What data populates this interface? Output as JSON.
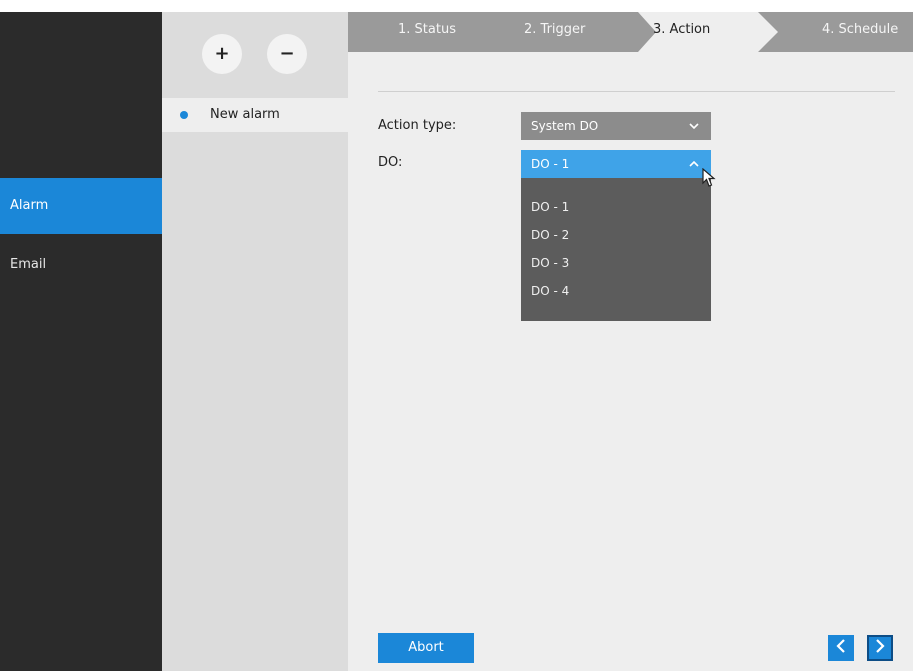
{
  "sidebar": {
    "items": [
      {
        "label": "Alarm",
        "active": true
      },
      {
        "label": "Email",
        "active": false
      }
    ]
  },
  "list": {
    "add_icon": "plus-icon",
    "remove_icon": "minus-icon",
    "add_symbol": "+",
    "remove_symbol": "−",
    "items": [
      {
        "label": "New alarm"
      }
    ]
  },
  "steps": [
    {
      "label": "1. Status"
    },
    {
      "label": "2. Trigger"
    },
    {
      "label": "3. Action"
    },
    {
      "label": "4. Schedule"
    }
  ],
  "form": {
    "action_type_label": "Action type:",
    "action_type_value": "System DO",
    "do_label": "DO:",
    "do_value": "DO - 1",
    "do_options": [
      "DO - 1",
      "DO - 2",
      "DO - 3",
      "DO - 4"
    ]
  },
  "footer": {
    "abort_label": "Abort",
    "prev_icon": "chevron-left-icon",
    "next_icon": "chevron-right-icon"
  },
  "colors": {
    "accent": "#1b87d8",
    "nav_bg": "#2b2b2b",
    "select_open": "#3fa3e8"
  }
}
